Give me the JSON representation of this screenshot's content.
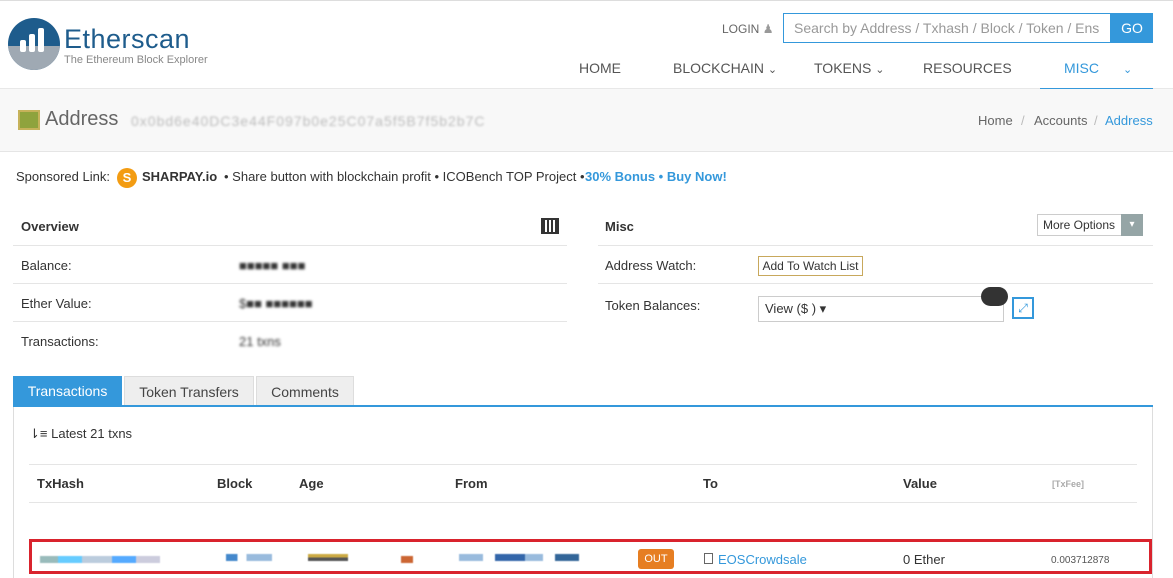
{
  "header": {
    "brand": "Etherscan",
    "tagline": "The Ethereum Block Explorer",
    "login": "LOGIN",
    "search_placeholder": "Search by Address / Txhash / Block / Token / Ens",
    "search_button": "GO",
    "nav": [
      {
        "label": "HOME",
        "caret": ""
      },
      {
        "label": "BLOCKCHAIN",
        "caret": "⌄"
      },
      {
        "label": "TOKENS",
        "caret": "⌄"
      },
      {
        "label": "RESOURCES",
        "caret": ""
      },
      {
        "label": "MISC",
        "caret": "⌄",
        "active": true
      }
    ]
  },
  "subheader": {
    "title": "Address",
    "address": "0x0bd6e40DC3e44F097b0e25C07a5f5B7f5b2b7C",
    "breadcrumb": [
      "Home",
      "Accounts",
      "Address"
    ]
  },
  "sponsored": {
    "label": "Sponsored Link:",
    "name": "SHARPAY.io",
    "description": "• Share button with blockchain profit • ICOBench TOP Project •",
    "cta": "30% Bonus • Buy Now!"
  },
  "overview": {
    "title": "Overview",
    "balance_label": "Balance:",
    "balance_value": "■■■■■ ■■■",
    "ether_value_label": "Ether Value:",
    "ether_value": "$■■ ■■■■■■",
    "transactions_label": "Transactions:",
    "transactions_value": "21 txns"
  },
  "misc": {
    "title": "Misc",
    "more_options": "More Options",
    "address_watch_label": "Address Watch:",
    "add_watch": "Add To Watch List",
    "token_balances_label": "Token Balances:",
    "token_select": "View ($           ) ▾"
  },
  "tabs": [
    "Transactions",
    "Token Transfers",
    "Comments"
  ],
  "transactions": {
    "latest": "Latest 21 txns",
    "columns": [
      "TxHash",
      "Block",
      "Age",
      "From",
      "To",
      "Value",
      "[TxFee]"
    ],
    "rows": [
      {
        "direction": "OUT",
        "to": "EOSCrowdsale",
        "value": "0 Ether",
        "fee": "0.003712878"
      }
    ]
  },
  "colors": {
    "accent": "#3498db",
    "brand": "#1e5c8c",
    "out_badge": "#e67e22",
    "highlight": "#d9232d"
  }
}
